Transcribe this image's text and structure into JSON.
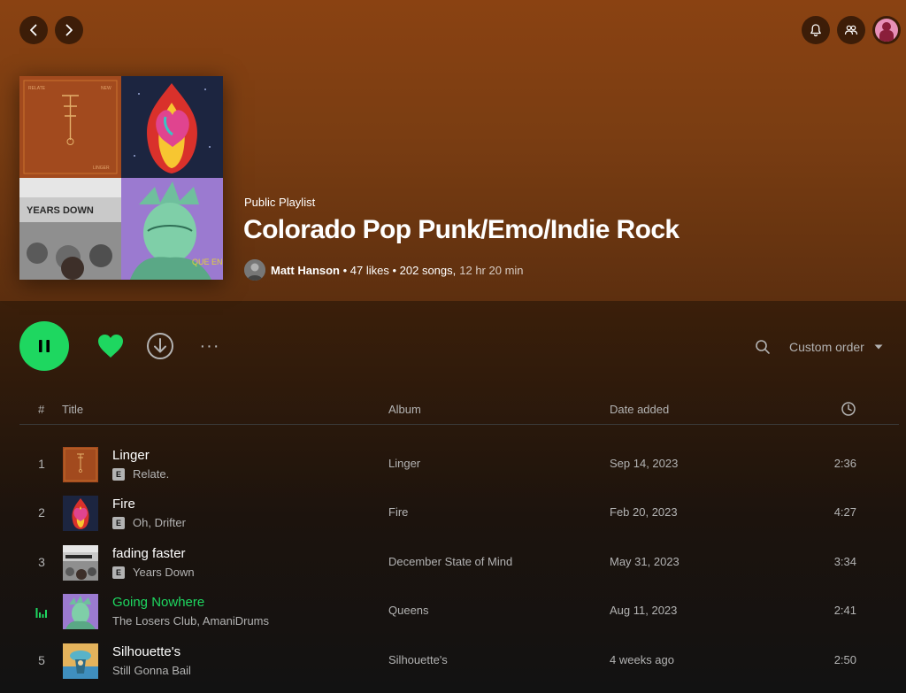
{
  "nav": {
    "back_icon": "chevron-left-icon",
    "forward_icon": "chevron-right-icon"
  },
  "topbar": {
    "notifications_icon": "bell-icon",
    "friends_icon": "friends-icon",
    "avatar_icon": "user-avatar"
  },
  "playlist": {
    "type_label": "Public Playlist",
    "title": "Colorado Pop Punk/Emo/Indie Rock",
    "owner": "Matt Hanson",
    "likes": "47 likes",
    "songs": "202 songs,",
    "duration": "12 hr 20 min",
    "separator": " • "
  },
  "cover_art": {
    "tl_header_left": "RELATE",
    "tl_header_right": "NEW",
    "tl_footer": "LINGER",
    "bl_text": "YEARS DOWN",
    "br_text": "QUE ENS"
  },
  "controls": {
    "play_state": "playing",
    "liked": true,
    "sort_label": "Custom order",
    "more_glyph": "···"
  },
  "table": {
    "headers": {
      "num": "#",
      "title": "Title",
      "album": "Album",
      "date_added": "Date added",
      "duration_icon": "clock-icon"
    },
    "rows": [
      {
        "num": "1",
        "title": "Linger",
        "explicit": true,
        "explicit_label": "E",
        "artist": "Relate.",
        "album": "Linger",
        "date_added": "Sep 14, 2023",
        "duration": "2:36",
        "playing": false
      },
      {
        "num": "2",
        "title": "Fire",
        "explicit": true,
        "explicit_label": "E",
        "artist": "Oh, Drifter",
        "album": "Fire",
        "date_added": "Feb 20, 2023",
        "duration": "4:27",
        "playing": false
      },
      {
        "num": "3",
        "title": "fading faster",
        "explicit": true,
        "explicit_label": "E",
        "artist": "Years Down",
        "album": "December State of Mind",
        "date_added": "May 31, 2023",
        "duration": "3:34",
        "playing": false
      },
      {
        "num": "",
        "title": "Going Nowhere",
        "explicit": false,
        "explicit_label": "",
        "artist": "The Losers Club, AmaniDrums",
        "album": "Queens",
        "date_added": "Aug 11, 2023",
        "duration": "2:41",
        "playing": true
      },
      {
        "num": "5",
        "title": "Silhouette's",
        "explicit": false,
        "explicit_label": "",
        "artist": "Still Gonna Bail",
        "album": "Silhouette's",
        "date_added": "4 weeks ago",
        "duration": "2:50",
        "playing": false
      }
    ]
  },
  "colors": {
    "accent": "#1ed760",
    "hero_top": "#8a4212",
    "background": "#121212",
    "muted_text": "#b3b3b3"
  }
}
